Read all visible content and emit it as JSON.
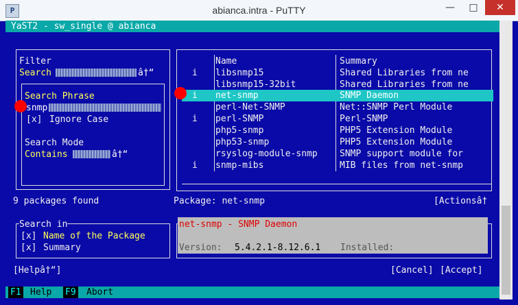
{
  "window": {
    "title": "abianca.intra - PuTTY",
    "app_icon": "putty-icon",
    "controls": [
      "minimize-icon",
      "maximize-icon",
      "close-icon"
    ]
  },
  "yast": {
    "header": "YaST2 - sw_single @ abianca",
    "filter": {
      "label": "Filter",
      "value": "Search",
      "arrow": "â†“"
    },
    "search_phrase": {
      "label": "Search Phrase",
      "value": "snmp",
      "ignore_case_check": "[x]",
      "ignore_case_label": "Ignore Case"
    },
    "search_mode": {
      "label": "Search Mode",
      "value": "Contains",
      "arrow": "â†“"
    },
    "found_text": "9 packages found",
    "search_in": {
      "label": "Search in",
      "items": [
        {
          "check": "[x]",
          "label": "Name of the Package"
        },
        {
          "check": "[x]",
          "label": "Summary"
        }
      ]
    },
    "help_button": "[Helpâ†“]",
    "table": {
      "columns": [
        "Name",
        "Summary"
      ],
      "rows": [
        {
          "status": "i",
          "name": "libsnmp15",
          "summary": "Shared Libraries from ne"
        },
        {
          "status": "",
          "name": "libsnmp15-32bit",
          "summary": "Shared Libraries from ne"
        },
        {
          "status": "i",
          "name": "net-snmp",
          "summary": "SNMP Daemon"
        },
        {
          "status": "",
          "name": "perl-Net-SNMP",
          "summary": "Net::SNMP Perl Module"
        },
        {
          "status": "i",
          "name": "perl-SNMP",
          "summary": "Perl-SNMP"
        },
        {
          "status": "",
          "name": "php5-snmp",
          "summary": "PHP5 Extension Module"
        },
        {
          "status": "",
          "name": "php53-snmp",
          "summary": "PHP5 Extension Module"
        },
        {
          "status": "",
          "name": "rsyslog-module-snmp",
          "summary": "SNMP support module for"
        },
        {
          "status": "i",
          "name": "snmp-mibs",
          "summary": "MIB files from net-snmp"
        }
      ]
    },
    "package_label": "Package: net-snmp",
    "actions_button": "[Actionsâ†",
    "info": {
      "title": "net-snmp - SNMP Daemon",
      "version_label": "Version:",
      "version_value": "5.4.2.1-8.12.6.1",
      "installed_label": "Installed:"
    },
    "cancel_button": "[Cancel]",
    "accept_button": "[Accept]",
    "fkeys": [
      {
        "key": "F1",
        "label": "Help"
      },
      {
        "key": "F9",
        "label": "Abort"
      }
    ]
  }
}
